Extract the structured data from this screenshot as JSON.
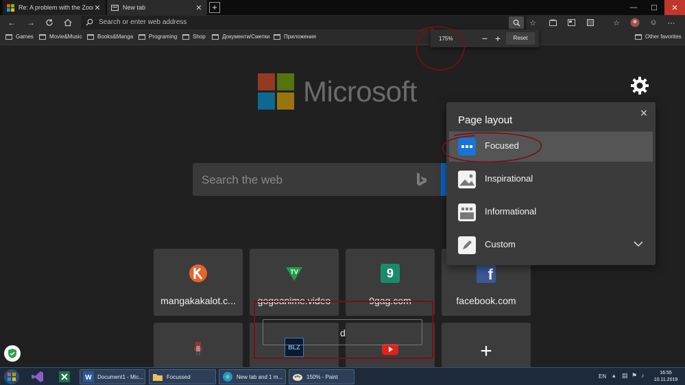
{
  "tabs": [
    {
      "title": "Re: A problem with the Zoom le",
      "favicon": "windows-logo-icon"
    },
    {
      "title": "New tab",
      "favicon": "newtab-page-icon"
    }
  ],
  "address_bar": {
    "placeholder": "Search or enter web address"
  },
  "favorites": {
    "items": [
      "Games",
      "Movie&Music",
      "Books&Manga",
      "Programing",
      "Shop",
      "Документи/Сметки",
      "Приложения"
    ],
    "other": "Other favorites"
  },
  "zoom_popup": {
    "level": "175%",
    "minus": "−",
    "plus": "+",
    "reset": "Reset"
  },
  "brand": {
    "name": "Microsoft"
  },
  "search": {
    "placeholder": "Search the web",
    "accent": "#0a66c2"
  },
  "tiles": [
    {
      "label": "mangakakalot.c...",
      "icon": "mangakakalot-icon"
    },
    {
      "label": "gogoanime.video",
      "icon": "gogoanime-icon"
    },
    {
      "label": "9gag.com",
      "icon": "9gag-icon",
      "glyph": "9"
    },
    {
      "label": "facebook.com",
      "icon": "facebook-icon",
      "glyph": "f"
    }
  ],
  "tiles_row2": [
    {
      "icon": "pixel-character-icon"
    },
    {
      "icon": "blizzard-icon",
      "glyph": "BLZ"
    },
    {
      "icon": "youtube-icon"
    },
    {
      "icon": "add-site-icon",
      "glyph": "+"
    }
  ],
  "partial_text": "d",
  "layout_panel": {
    "title": "Page layout",
    "options": [
      {
        "label": "Focused",
        "icon": "focused-layout-icon",
        "selected": true
      },
      {
        "label": "Inspirational",
        "icon": "inspirational-layout-icon",
        "selected": false
      },
      {
        "label": "Informational",
        "icon": "informational-layout-icon",
        "selected": false
      },
      {
        "label": "Custom",
        "icon": "custom-layout-icon",
        "selected": false
      }
    ]
  },
  "taskbar": {
    "buttons": [
      {
        "label": "Document1 - Mic..."
      },
      {
        "label": "Focussed"
      },
      {
        "label": "New tab and 1 m..."
      },
      {
        "label": "150% - Paint"
      }
    ],
    "language": "EN",
    "time": "16:55",
    "date": "10.11.2019"
  },
  "colors": {
    "accent_blue": "#0a66c2",
    "annotation_red": "#7a0f16",
    "panel_bg": "#3b3b3b"
  }
}
